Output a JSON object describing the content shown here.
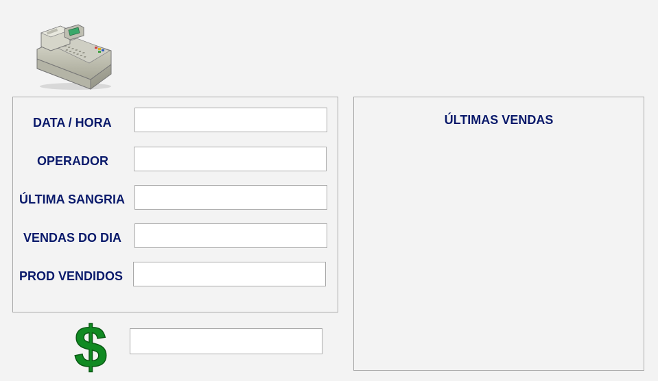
{
  "icons": {
    "register": "cash-register-icon",
    "dollar": "dollar-sign-icon"
  },
  "colors": {
    "label": "#0a1a6b",
    "background": "#f3f3f3",
    "border": "#a9a9a9",
    "dollar_green": "#1a9a2a"
  },
  "info": {
    "datetime_label": "DATA / HORA",
    "datetime_value": "",
    "operator_label": "OPERADOR",
    "operator_value": "",
    "last_withdrawal_label": "ÚLTIMA SANGRIA",
    "last_withdrawal_value": "",
    "daily_sales_label": "VENDAS DO DIA",
    "daily_sales_value": "",
    "products_sold_label": "PROD VENDIDOS",
    "products_sold_value": ""
  },
  "sales": {
    "title": "ÚLTIMAS VENDAS",
    "items": []
  },
  "total": {
    "value": ""
  }
}
